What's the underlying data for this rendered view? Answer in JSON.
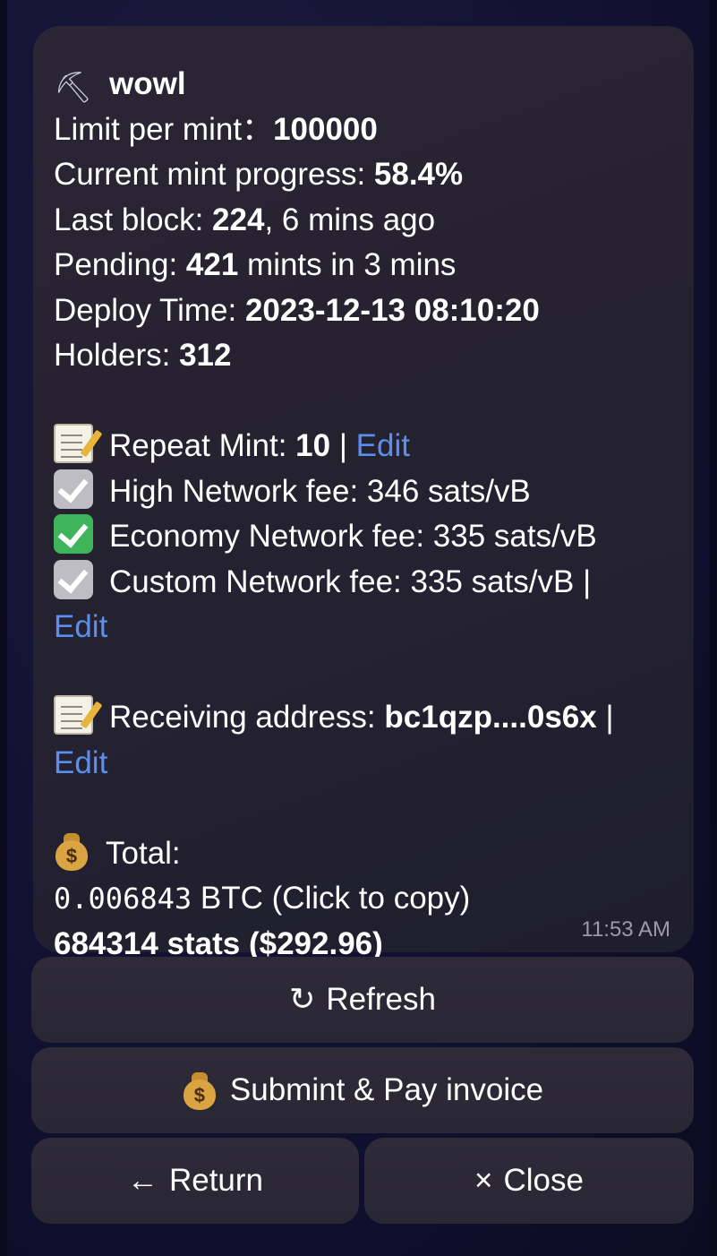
{
  "message": {
    "title": "wowl",
    "limit_label": "Limit per mint：",
    "limit_value": "100000",
    "progress_label": "Current mint progress: ",
    "progress_value": "58.4%",
    "last_block_label": "Last block: ",
    "last_block_value": "224",
    "last_block_suffix": ", 6 mins ago",
    "pending_label": "Pending: ",
    "pending_value": "421",
    "pending_suffix": " mints in 3 mins",
    "deploy_label": "Deploy Time: ",
    "deploy_value": "2023-12-13 08:10:20",
    "holders_label": "Holders: ",
    "holders_value": "312",
    "repeat_label": "Repeat Mint: ",
    "repeat_value": "10",
    "separator": " | ",
    "edit_label": "Edit",
    "fee_high": "High Network fee: 346 sats/vB",
    "fee_economy": "Economy Network fee: 335 sats/vB",
    "fee_custom": "Custom Network fee: 335 sats/vB |",
    "address_label": "Receiving address: ",
    "address_value": "bc1qzp....0s6x",
    "address_sep": " |",
    "total_label": "Total:",
    "total_btc_value": "0.006843",
    "total_btc_suffix": " BTC (Click to copy)",
    "total_sats": "684314 stats ($292.96)",
    "time": "11:53 AM"
  },
  "buttons": {
    "refresh_icon": "↻",
    "refresh": "Refresh",
    "submit": "Submint & Pay invoice",
    "return_icon": "←",
    "return": "Return",
    "close_icon": "×",
    "close": "Close"
  },
  "icons": {
    "title": "pick-icon",
    "repeat": "memo-icon",
    "high_fee": "gray-check-icon",
    "economy_fee": "green-check-icon",
    "custom_fee": "gray-check-icon",
    "address": "memo-icon",
    "total": "money-bag-icon",
    "submit": "money-bag-icon"
  },
  "colors": {
    "link": "#5a8ff0",
    "green_check": "#3fb55b",
    "background": "#121132"
  }
}
